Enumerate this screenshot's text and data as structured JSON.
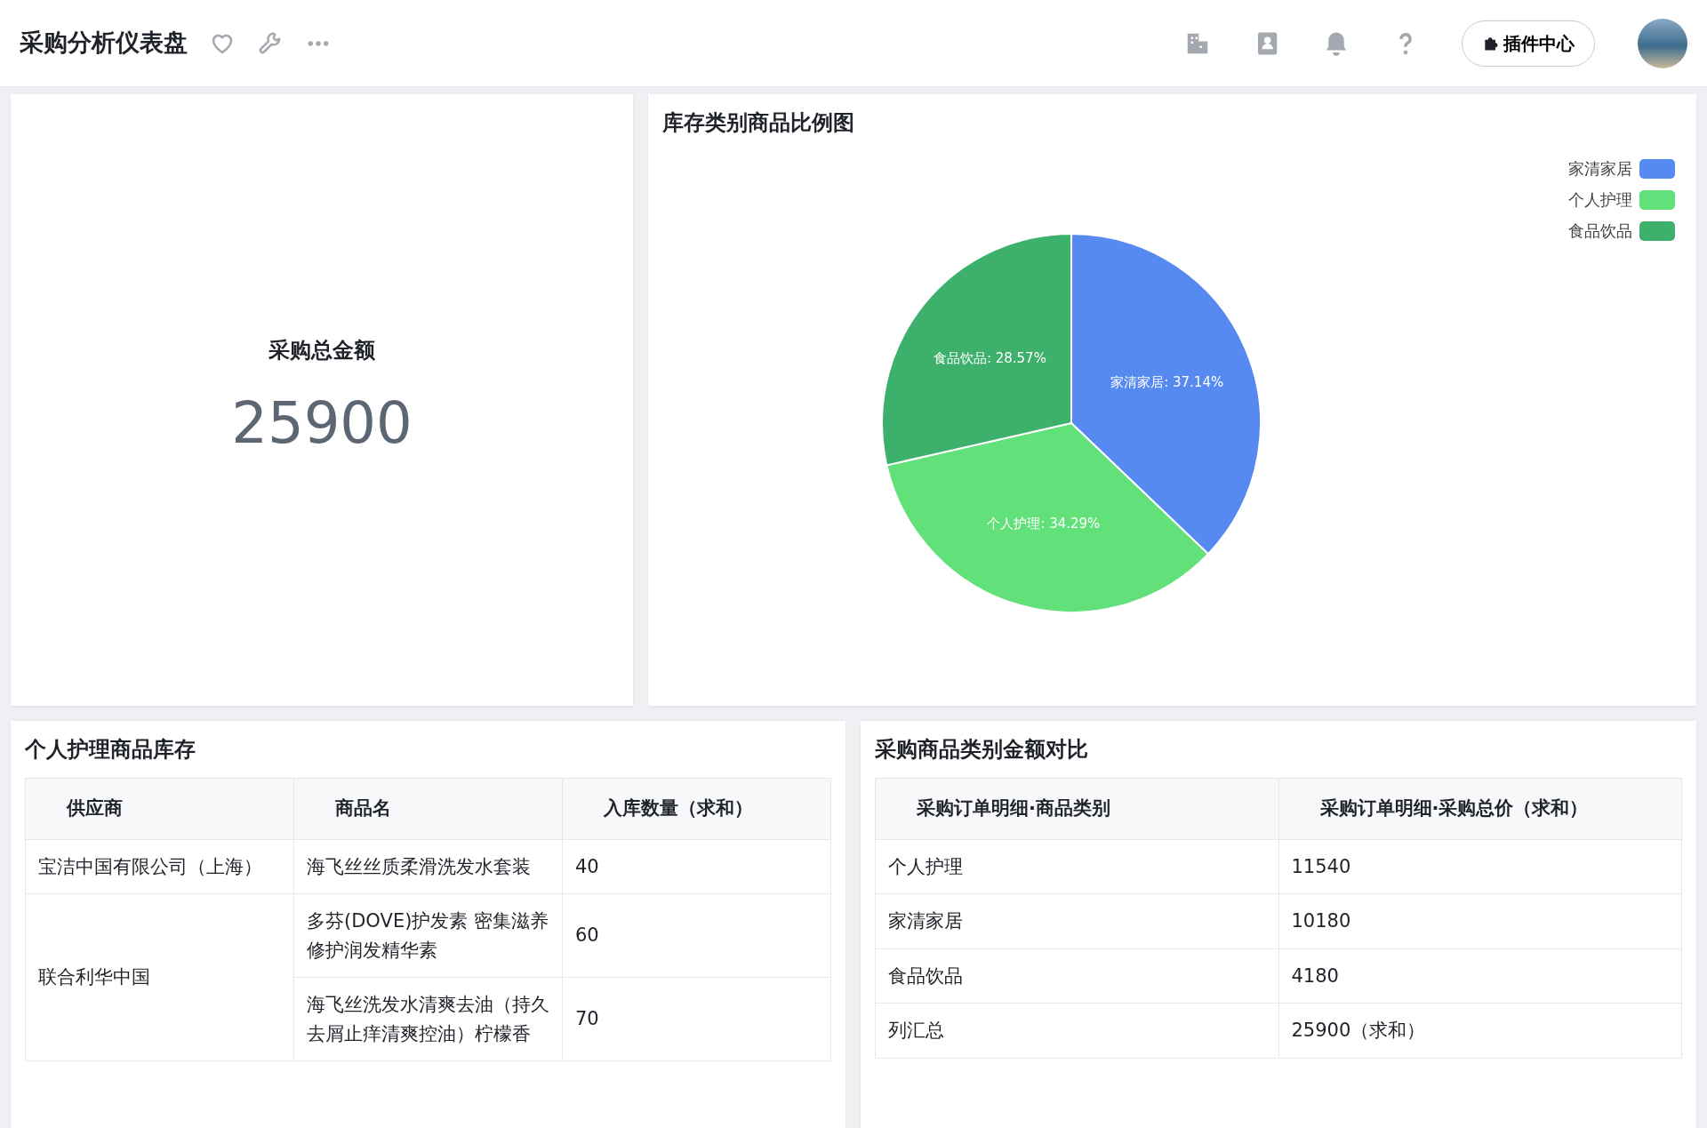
{
  "header": {
    "title": "采购分析仪表盘",
    "plugin_button": "插件中心"
  },
  "kpi": {
    "label": "采购总金额",
    "value": "25900"
  },
  "pie_panel": {
    "title": "库存类别商品比例图",
    "chart_data": {
      "type": "pie",
      "categories": [
        "家清家居",
        "个人护理",
        "食品饮品"
      ],
      "values": [
        37.14,
        34.29,
        28.57
      ],
      "colors": [
        "#568af0",
        "#62e07a",
        "#3db06c"
      ],
      "data_labels": true,
      "value_labels": [
        "家清家居: 37.14%",
        "个人护理: 34.29%",
        "食品饮品: 28.57%"
      ]
    }
  },
  "stock_table": {
    "title": "个人护理商品库存",
    "columns": [
      "供应商",
      "商品名",
      "入库数量（求和）"
    ],
    "groups": [
      {
        "supplier": "宝洁中国有限公司（上海）",
        "rows": [
          {
            "product": "海飞丝丝质柔滑洗发水套装",
            "qty": "40"
          }
        ]
      },
      {
        "supplier": "联合利华中国",
        "rows": [
          {
            "product": "多芬(DOVE)护发素 密集滋养修护润发精华素",
            "qty": "60"
          },
          {
            "product": "海飞丝洗发水清爽去油（持久去屑止痒清爽控油）柠檬香",
            "qty": "70"
          }
        ]
      }
    ]
  },
  "amount_table": {
    "title": "采购商品类别金额对比",
    "columns": [
      "采购订单明细·商品类别",
      "采购订单明细·采购总价（求和）"
    ],
    "rows": [
      [
        "个人护理",
        "11540"
      ],
      [
        "家清家居",
        "10180"
      ],
      [
        "食品饮品",
        "4180"
      ],
      [
        "列汇总",
        "25900（求和）"
      ]
    ]
  }
}
